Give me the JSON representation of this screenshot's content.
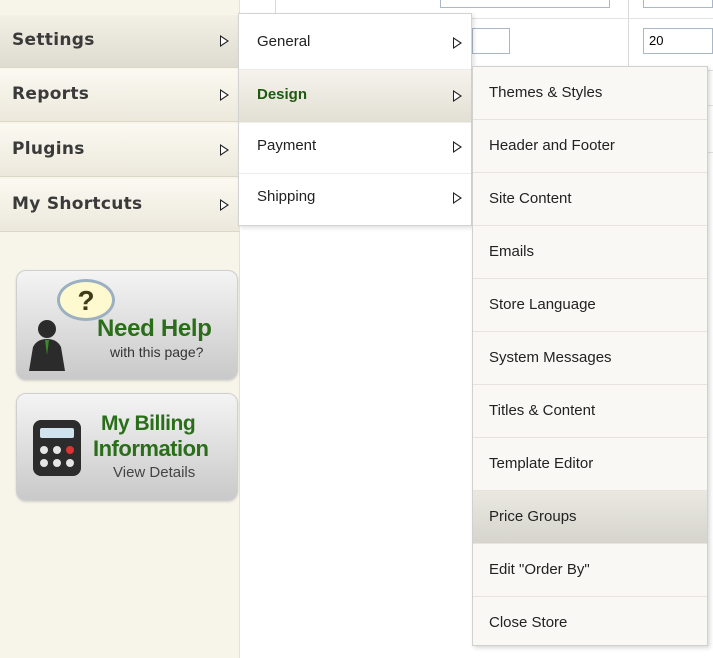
{
  "background": {
    "input_value": "20"
  },
  "sidebar": {
    "items": [
      {
        "label": "Settings"
      },
      {
        "label": "Reports"
      },
      {
        "label": "Plugins"
      },
      {
        "label": "My Shortcuts"
      }
    ]
  },
  "promos": {
    "help": {
      "title": "Need Help",
      "subtitle": "with this page?",
      "bubble": "?"
    },
    "billing": {
      "line1": "My Billing",
      "line2": "Information",
      "line3": "View Details"
    }
  },
  "settings_submenu": {
    "items": [
      {
        "label": "General"
      },
      {
        "label": "Design"
      },
      {
        "label": "Payment"
      },
      {
        "label": "Shipping"
      }
    ]
  },
  "design_submenu": {
    "items": [
      {
        "label": "Themes & Styles"
      },
      {
        "label": "Header and Footer"
      },
      {
        "label": "Site Content"
      },
      {
        "label": "Emails"
      },
      {
        "label": "Store Language"
      },
      {
        "label": "System Messages"
      },
      {
        "label": "Titles & Content"
      },
      {
        "label": "Template Editor"
      },
      {
        "label": "Price Groups"
      },
      {
        "label": "Edit \"Order By\""
      },
      {
        "label": "Close Store"
      }
    ]
  },
  "colors": {
    "accent_green": "#2a6e1a",
    "active_label": "#1f5a10"
  }
}
